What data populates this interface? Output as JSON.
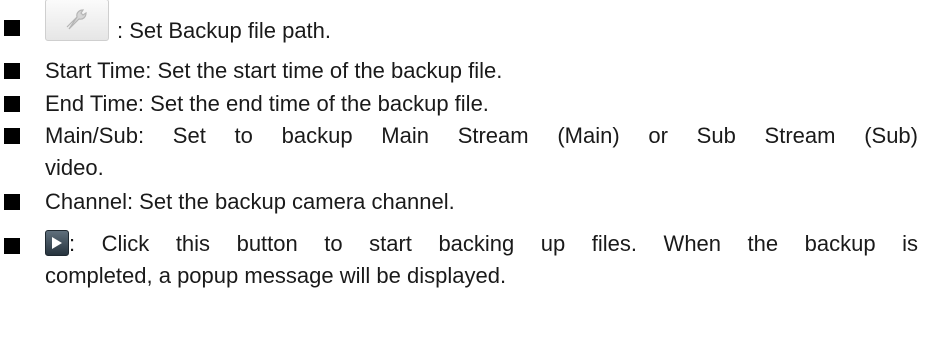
{
  "items": [
    {
      "text": ": Set Backup file path.",
      "icon": "wrench-icon"
    },
    {
      "text": "Start Time: Set the start time of the backup file."
    },
    {
      "text": "End Time: Set the end time of the backup file."
    },
    {
      "line1": "Main/Sub: Set to backup Main Stream (Main) or Sub Stream (Sub)",
      "line2": "video."
    },
    {
      "text": "Channel: Set the backup camera channel."
    },
    {
      "line1": ": Click this button to start backing up files. When the backup is",
      "line2": "completed, a popup message will be displayed.",
      "icon": "play-icon"
    }
  ]
}
